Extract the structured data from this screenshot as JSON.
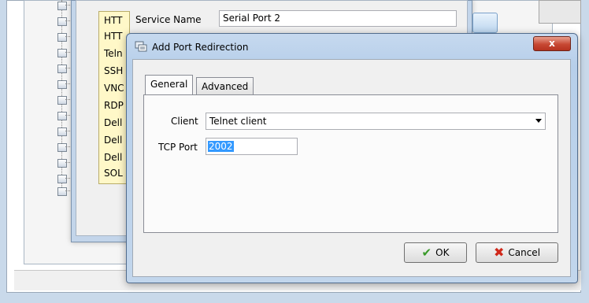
{
  "background": {
    "service_name_label": "Service Name",
    "service_name_value": "Serial Port 2",
    "list_items": [
      "HTT",
      "HTT",
      "Teln",
      "SSH",
      "VNC",
      "RDP",
      "Dell",
      "Dell",
      "Dell",
      "SOL"
    ]
  },
  "dialog": {
    "title": "Add Port Redirection",
    "close_label": "x",
    "tabs": [
      "General",
      "Advanced"
    ],
    "active_tab": "General",
    "client_label": "Client",
    "client_value": "Telnet client",
    "tcp_port_label": "TCP Port",
    "tcp_port_value": "2002",
    "ok_label": "OK",
    "cancel_label": "Cancel"
  },
  "icons": {
    "ok": "check-icon",
    "cancel": "x-icon",
    "title": "port-redirection-icon",
    "dropdown": "chevron-down-icon"
  },
  "colors": {
    "selection": "#3399ff",
    "close_button": "#c74833",
    "title_bar": "#b7cfea"
  }
}
